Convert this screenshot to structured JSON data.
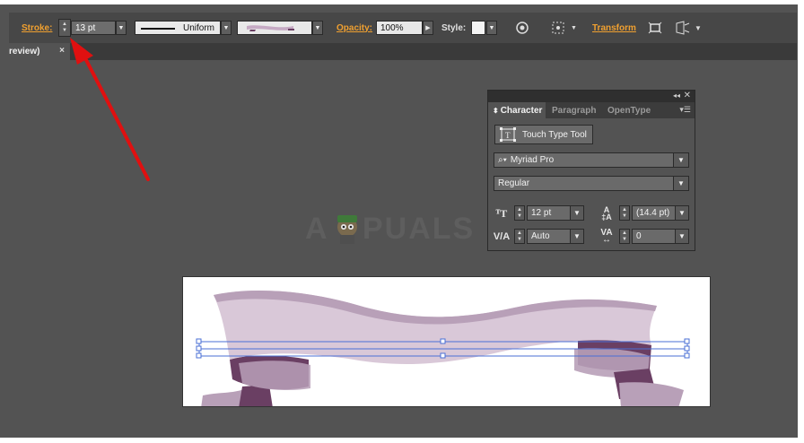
{
  "controlbar": {
    "stroke_label": "Stroke:",
    "stroke_weight": "13 pt",
    "profile_label": "Uniform",
    "opacity_label": "Opacity:",
    "opacity_value": "100%",
    "style_label": "Style:",
    "transform_label": "Transform"
  },
  "tab": {
    "title": "review)",
    "close": "×"
  },
  "watermark": "A  PUALS",
  "character_panel": {
    "tabs": [
      "Character",
      "Paragraph",
      "OpenType"
    ],
    "touch_type_label": "Touch Type Tool",
    "font_family": "Myriad Pro",
    "font_style": "Regular",
    "font_size": "12 pt",
    "leading": "(14.4 pt)",
    "kerning": "Auto",
    "tracking": "0"
  },
  "colors": {
    "accent_link": "#f0a030",
    "ribbon_light": "#d9c8d8",
    "ribbon_mid": "#b8a0b8",
    "ribbon_dark": "#6a3f63",
    "selection": "#4a6fd6",
    "annotation_arrow": "#e01010"
  }
}
